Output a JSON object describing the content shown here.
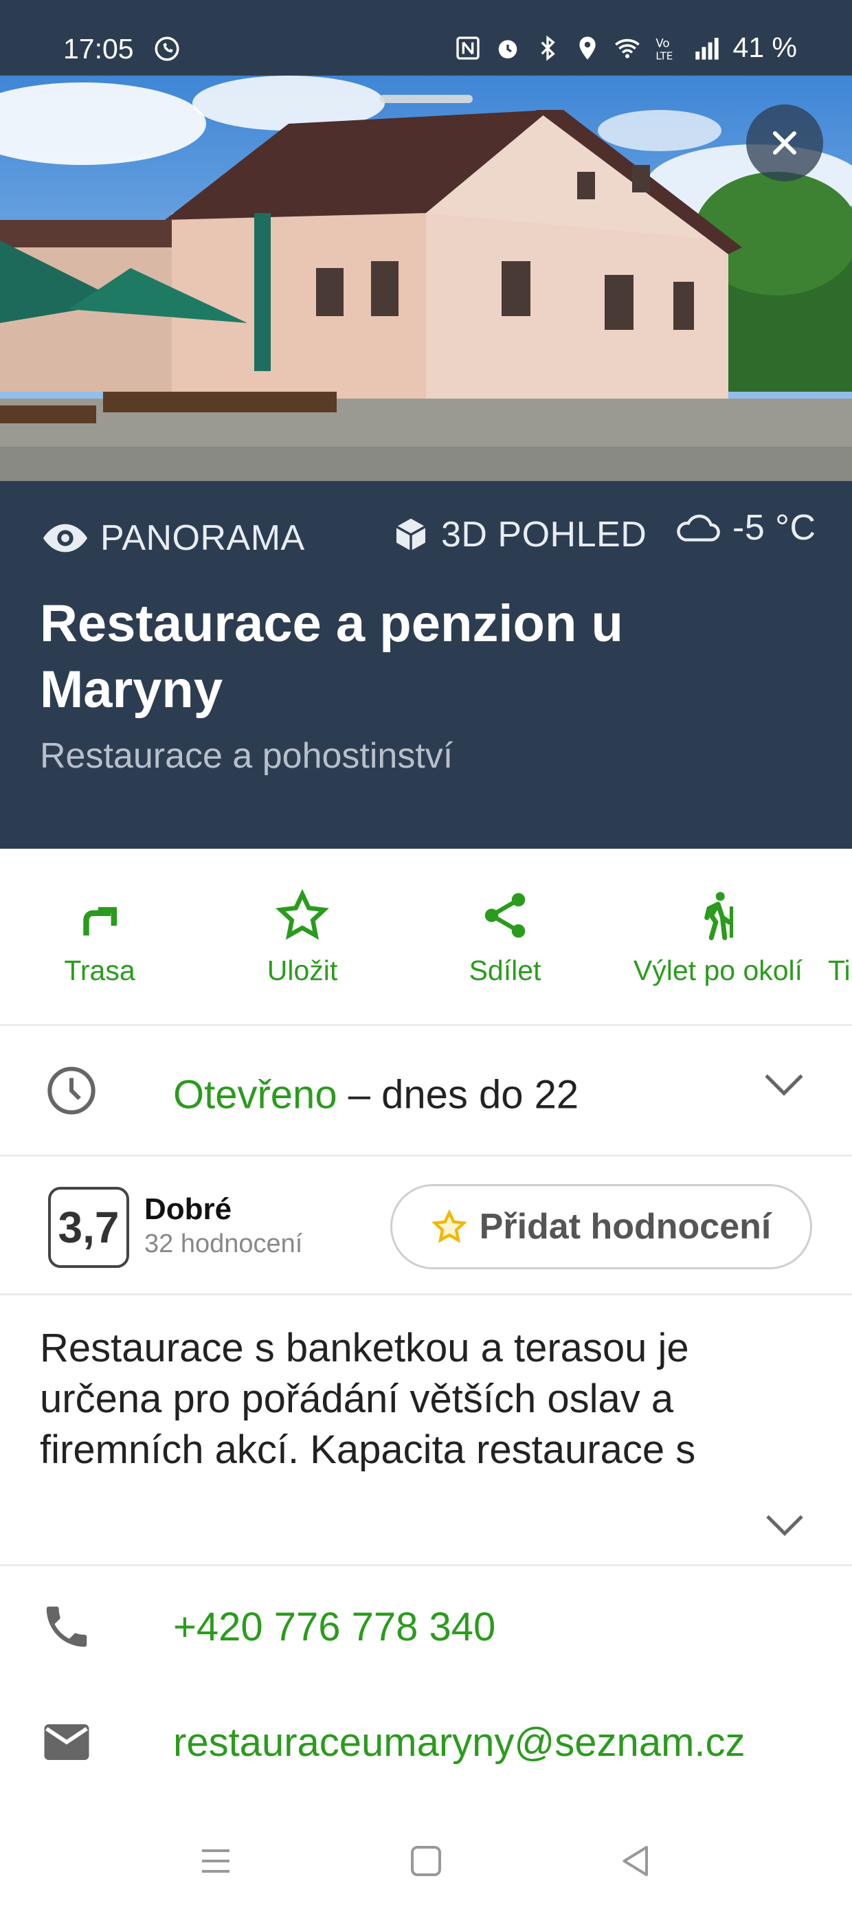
{
  "status_bar": {
    "time": "17:05",
    "battery": "41 %",
    "icons": [
      "whatsapp-icon",
      "nfc-icon",
      "alarm-icon",
      "bluetooth-icon",
      "location-icon",
      "wifi-icon",
      "volte-icon",
      "signal-icon"
    ]
  },
  "hero": {
    "close_icon": "close-icon"
  },
  "header": {
    "panorama_label": "PANORAMA",
    "view3d_label": "3D POHLED",
    "weather": "-5 °C",
    "title": "Restaurace a penzion u Maryny",
    "subtitle": "Restaurace a pohostinství"
  },
  "actions": [
    {
      "label": "Trasa",
      "icon": "route-icon"
    },
    {
      "label": "Uložit",
      "icon": "star-icon"
    },
    {
      "label": "Sdílet",
      "icon": "share-icon"
    },
    {
      "label": "Výlet po okolí",
      "icon": "hiker-icon"
    },
    {
      "label": "Ti",
      "icon": ""
    }
  ],
  "hours": {
    "status": "Otevřeno",
    "detail": " – dnes do 22"
  },
  "rating": {
    "score": "3,7",
    "word": "Dobré",
    "count": "32 hodnocení",
    "add_label": "Přidat hodnocení"
  },
  "description": "Restaurace s banketkou a terasou je určena pro pořádání větších oslav a firemních akcí. Kapacita restaurace s",
  "contacts": {
    "phone": "+420 776 778 340",
    "email": "restauraceumaryny@seznam.cz"
  },
  "colors": {
    "header_bg": "#2d3d51",
    "accent_green": "#2b9b1d",
    "star_yellow": "#f2b705"
  }
}
